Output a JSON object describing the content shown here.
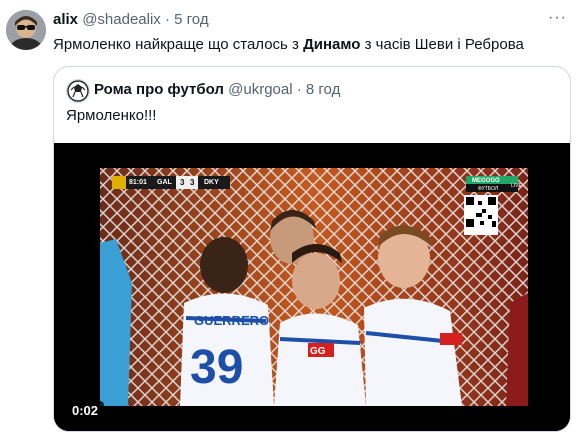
{
  "tweet": {
    "author_name": "alix",
    "author_handle": "@shadealix",
    "separator": "·",
    "time": "5 год",
    "text_before": "Ярмоленко найкраще що сталось з ",
    "text_bold": "Динамо",
    "text_after": " з часів Шеви і Реброва",
    "more_icon": "more-icon"
  },
  "quote": {
    "author_name": "Рома про футбол",
    "author_handle": "@ukrgoal",
    "separator": "·",
    "time": "8 год",
    "text": "Ярмоленко!!!",
    "video": {
      "duration": "0:02",
      "scoreboard": {
        "clock": "81:01",
        "home": "GAL",
        "home_score": "3",
        "away_score": "3",
        "away": "DKY"
      },
      "broadcaster": "MEGOGO",
      "broadcaster_sub": "ФУТБОЛ",
      "live_label": "LIVE",
      "jersey_name": "GUERRERO",
      "jersey_number": "39",
      "sponsor": "GG"
    }
  },
  "colors": {
    "text": "#0f1419",
    "muted": "#536471",
    "border": "#cfd9de",
    "dynamo_blue": "#1d4fa8"
  }
}
